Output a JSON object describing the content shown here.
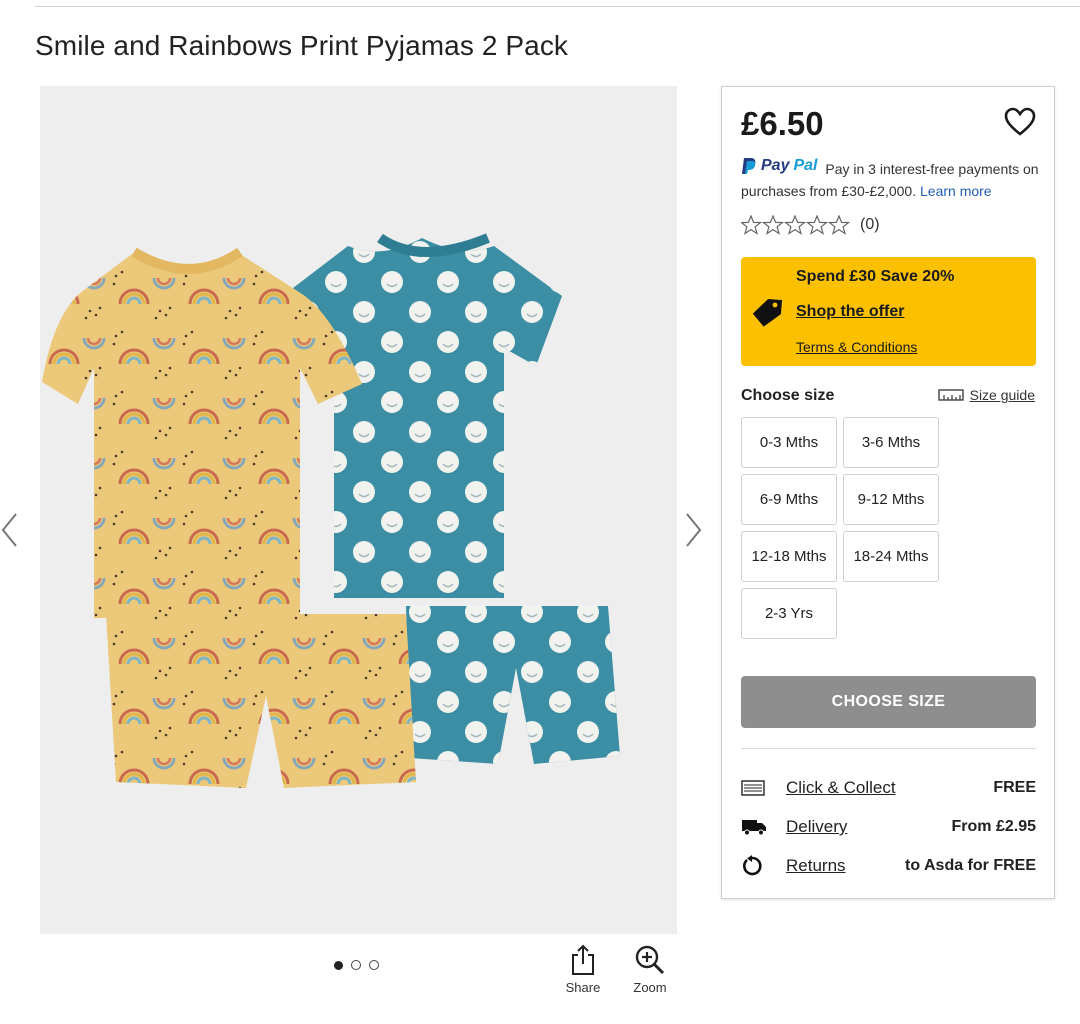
{
  "product": {
    "title": "Smile and Rainbows Print Pyjamas 2 Pack",
    "price": "£6.50"
  },
  "gallery": {
    "image_count": 3,
    "active_index": 0,
    "share_label": "Share",
    "zoom_label": "Zoom"
  },
  "paypal": {
    "brand_pay": "Pay",
    "brand_pal": "Pal",
    "text": "Pay in 3 interest-free payments on purchases from £30-£2,000.",
    "learn_more": "Learn more"
  },
  "rating": {
    "stars": 0,
    "max": 5,
    "count": "(0)"
  },
  "promo": {
    "headline": "Spend £30 Save 20%",
    "link": "Shop the offer",
    "terms": "Terms & Conditions",
    "color": "#fbc100"
  },
  "size": {
    "label": "Choose size",
    "guide": "Size guide",
    "options": [
      "0-3 Mths",
      "3-6 Mths",
      "6-9 Mths",
      "9-12 Mths",
      "12-18 Mths",
      "18-24 Mths",
      "2-3 Yrs"
    ]
  },
  "cta": {
    "label": "CHOOSE SIZE",
    "color": "#8e8e8e"
  },
  "services": [
    {
      "icon": "click-collect-icon",
      "label": "Click & Collect",
      "value": "FREE"
    },
    {
      "icon": "delivery-truck-icon",
      "label": "Delivery",
      "value": "From £2.95"
    },
    {
      "icon": "returns-icon",
      "label": "Returns",
      "value": "to Asda for FREE"
    }
  ]
}
